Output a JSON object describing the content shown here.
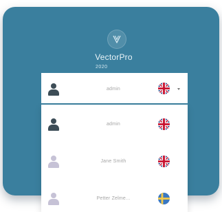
{
  "app": {
    "brand": "VectorPro",
    "version": "2020",
    "logo_icon": "vectorpro-logo-icon",
    "accent_color": "#3a7f9e"
  },
  "login": {
    "selected_user": {
      "name": "admin",
      "avatar_icon": "user-avatar-icon",
      "language_flag": "uk-flag-icon",
      "dropdown_icon": "chevron-down-icon"
    },
    "user_options": [
      {
        "name": "admin",
        "avatar_style": "dark",
        "language_flag": "uk-flag-icon"
      },
      {
        "name": "Jane Smith",
        "avatar_style": "light",
        "language_flag": "uk-flag-icon"
      },
      {
        "name": "Petter Zelme...",
        "avatar_style": "light",
        "language_flag": "sweden-flag-icon"
      }
    ]
  }
}
